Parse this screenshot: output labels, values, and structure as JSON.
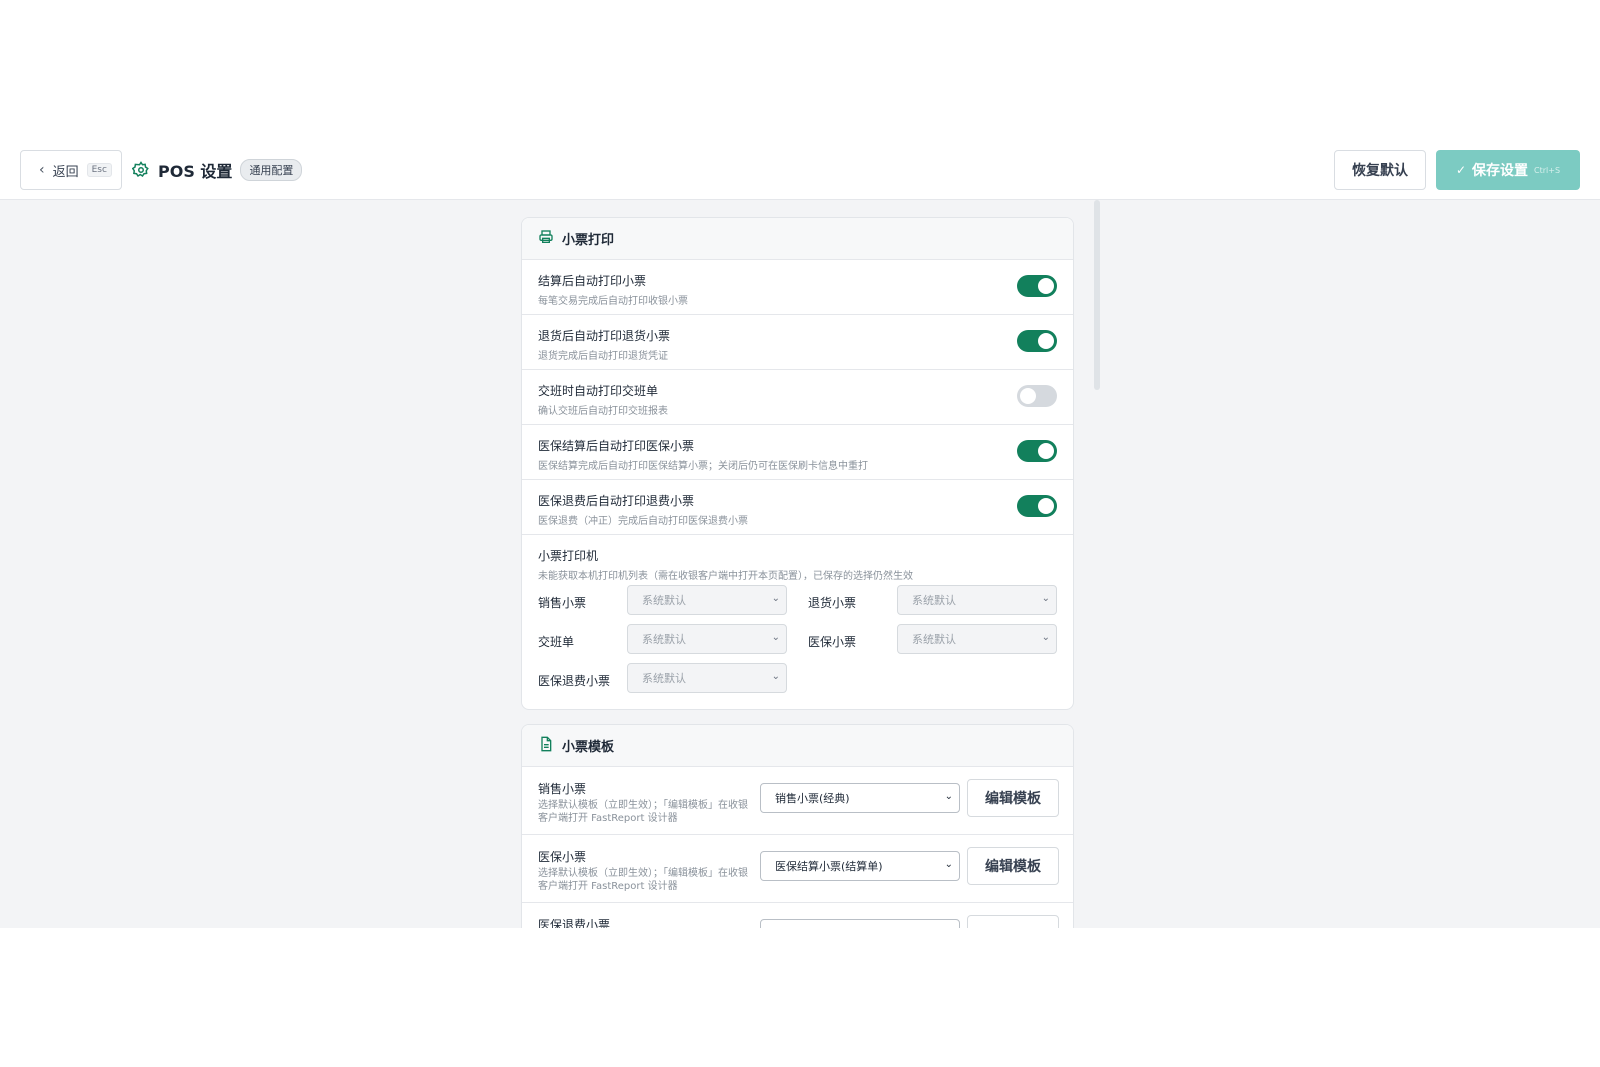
{
  "header": {
    "back_label": "返回",
    "back_shortcut": "Esc",
    "title": "POS 设置",
    "scope_badge": "通用配置",
    "restore_label": "恢复默认",
    "save_label": "保存设置",
    "save_shortcut": "Ctrl+S"
  },
  "colors": {
    "accent": "#12805c",
    "save_button": "#7ccbc2",
    "toggle_off": "#d5d9de"
  },
  "receipt_print": {
    "title": "小票打印",
    "icon": "printer-icon",
    "rows": [
      {
        "title": "结算后自动打印小票",
        "desc": "每笔交易完成后自动打印收银小票",
        "enabled": true
      },
      {
        "title": "退货后自动打印退货小票",
        "desc": "退货完成后自动打印退货凭证",
        "enabled": true
      },
      {
        "title": "交班时自动打印交班单",
        "desc": "确认交班后自动打印交班报表",
        "enabled": false
      },
      {
        "title": "医保结算后自动打印医保小票",
        "desc": "医保结算完成后自动打印医保结算小票；关闭后仍可在医保刷卡信息中重打",
        "enabled": true
      },
      {
        "title": "医保退费后自动打印退费小票",
        "desc": "医保退费（冲正）完成后自动打印医保退费小票",
        "enabled": true
      }
    ],
    "printer": {
      "title": "小票打印机",
      "desc": "未能获取本机打印机列表（需在收银客户端中打开本页配置），已保存的选择仍然生效",
      "fields": [
        {
          "label": "销售小票",
          "value": "系统默认"
        },
        {
          "label": "退货小票",
          "value": "系统默认"
        },
        {
          "label": "交班单",
          "value": "系统默认"
        },
        {
          "label": "医保小票",
          "value": "系统默认"
        },
        {
          "label": "医保退费小票",
          "value": "系统默认"
        }
      ]
    }
  },
  "receipt_template": {
    "title": "小票模板",
    "icon": "document-icon",
    "rows": [
      {
        "title": "销售小票",
        "desc": "选择默认模板（立即生效）；「编辑模板」在收银客户端打开 FastReport 设计器",
        "selected": "销售小票(经典)",
        "edit_label": "编辑模板"
      },
      {
        "title": "医保小票",
        "desc": "选择默认模板（立即生效）；「编辑模板」在收银客户端打开 FastReport 设计器",
        "selected": "医保结算小票(结算单)",
        "edit_label": "编辑模板"
      },
      {
        "title": "医保退费小票"
      }
    ]
  }
}
